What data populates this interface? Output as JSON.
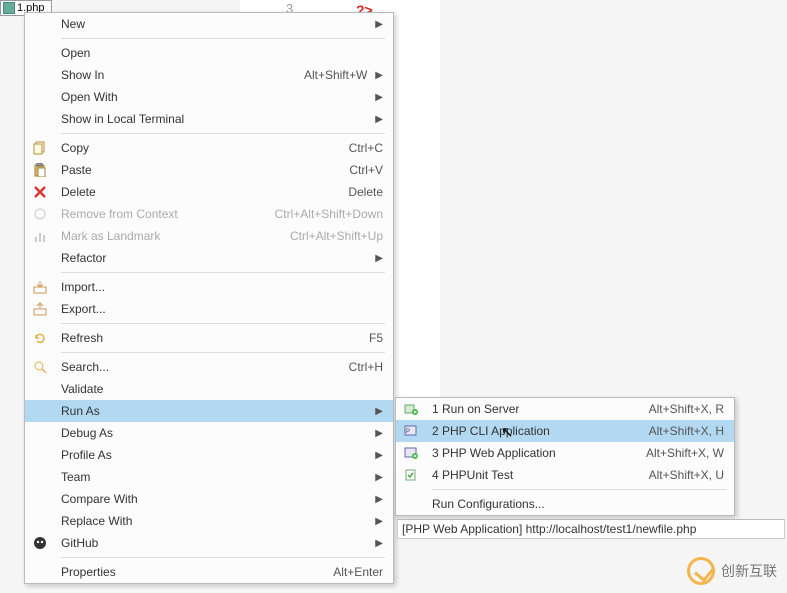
{
  "tab": {
    "label": "1.php"
  },
  "editor": {
    "line_number": "3",
    "error_mark": "?>"
  },
  "menu": {
    "new": "New",
    "open": "Open",
    "show_in": "Show In",
    "show_in_shortcut": "Alt+Shift+W",
    "open_with": "Open With",
    "show_local_terminal": "Show in Local Terminal",
    "copy": "Copy",
    "copy_shortcut": "Ctrl+C",
    "paste": "Paste",
    "paste_shortcut": "Ctrl+V",
    "delete": "Delete",
    "delete_shortcut": "Delete",
    "remove_context": "Remove from Context",
    "remove_context_shortcut": "Ctrl+Alt+Shift+Down",
    "mark_landmark": "Mark as Landmark",
    "mark_landmark_shortcut": "Ctrl+Alt+Shift+Up",
    "refactor": "Refactor",
    "import": "Import...",
    "export": "Export...",
    "refresh": "Refresh",
    "refresh_shortcut": "F5",
    "search": "Search...",
    "search_shortcut": "Ctrl+H",
    "validate": "Validate",
    "run_as": "Run As",
    "debug_as": "Debug As",
    "profile_as": "Profile As",
    "team": "Team",
    "compare_with": "Compare With",
    "replace_with": "Replace With",
    "github": "GitHub",
    "properties": "Properties",
    "properties_shortcut": "Alt+Enter"
  },
  "submenu": {
    "items": [
      {
        "label": "1 Run on Server",
        "shortcut": "Alt+Shift+X, R"
      },
      {
        "label": "2 PHP CLI Application",
        "shortcut": "Alt+Shift+X, H"
      },
      {
        "label": "3 PHP Web Application",
        "shortcut": "Alt+Shift+X, W"
      },
      {
        "label": "4 PHPUnit Test",
        "shortcut": "Alt+Shift+X, U"
      }
    ],
    "run_configs": "Run Configurations..."
  },
  "status": {
    "text": "[PHP Web Application] http://localhost/test1/newfile.php"
  },
  "watermark": {
    "text": "创新互联"
  }
}
